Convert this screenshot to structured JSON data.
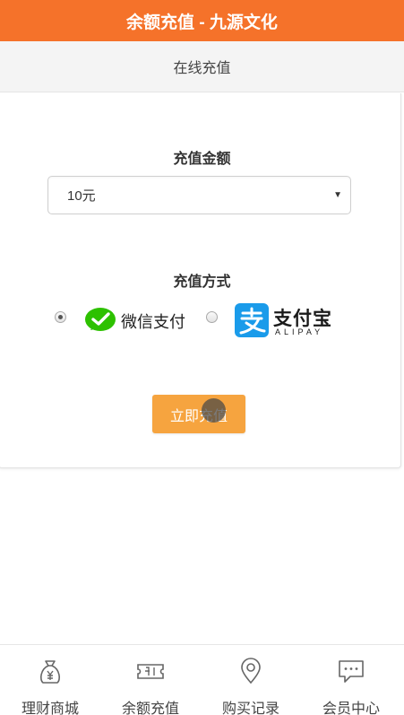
{
  "header": {
    "title": "余额充值 - 九源文化"
  },
  "subheader": {
    "title": "在线充值"
  },
  "form": {
    "amount_label": "充值金额",
    "amount_selected": "10元",
    "method_label": "充值方式",
    "methods": [
      {
        "id": "wechat",
        "label": "微信支付",
        "selected": true,
        "icon": "wechat-pay-logo"
      },
      {
        "id": "alipay",
        "label": "支付宝",
        "sublabel": "ALIPAY",
        "selected": false,
        "icon": "alipay-logo"
      }
    ],
    "submit_label": "立即充值"
  },
  "tabbar": {
    "items": [
      {
        "label": "理财商城",
        "icon": "money-bag-icon"
      },
      {
        "label": "余额充值",
        "icon": "ticket-icon"
      },
      {
        "label": "购买记录",
        "icon": "location-pin-icon"
      },
      {
        "label": "会员中心",
        "icon": "chat-bubble-icon"
      }
    ]
  },
  "colors": {
    "header_bg": "#f5722a",
    "button_bg": "#f6a43f",
    "wechat_green": "#2dc100",
    "alipay_blue": "#1a9bea"
  }
}
